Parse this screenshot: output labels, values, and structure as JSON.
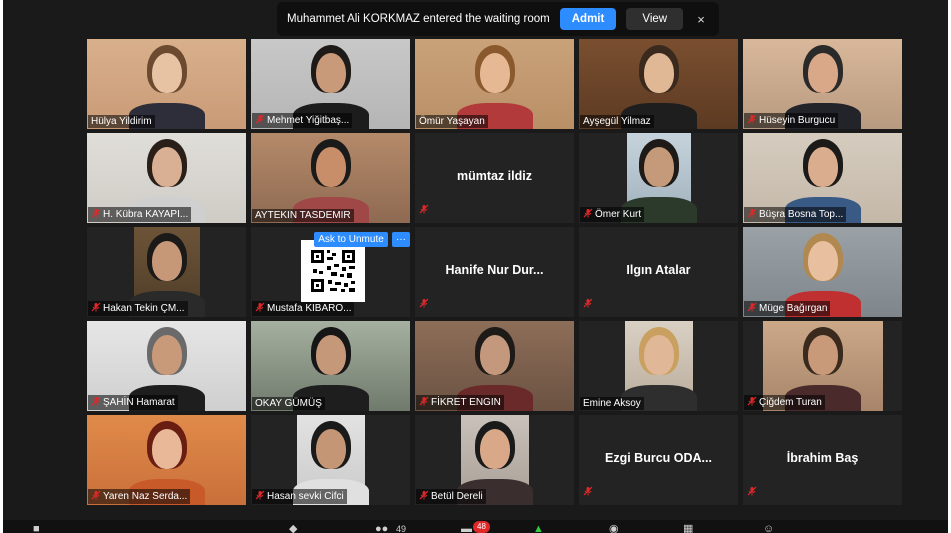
{
  "notification": {
    "message": "Muhammet Ali KORKMAZ entered the waiting room",
    "admit_label": "Admit",
    "view_label": "View",
    "close_label": "×"
  },
  "popup": {
    "ask_unmute_label": "Ask to Unmute",
    "more_label": "···"
  },
  "participants": [
    {
      "name": "Hülya Yildirim",
      "muted": false
    },
    {
      "name": "Mehmet Yiğitbaş...",
      "muted": true
    },
    {
      "name": "Ömür Yaşayan",
      "muted": false
    },
    {
      "name": "Ayşegül Yilmaz",
      "muted": false
    },
    {
      "name": "Hüseyin Burgucu",
      "muted": true
    },
    {
      "name": "H. Kübra KAYAPI...",
      "muted": true
    },
    {
      "name": "AYTEKIN TASDEMIR",
      "muted": false
    },
    {
      "name": "mümtaz ildiz",
      "muted": true,
      "video_off": true
    },
    {
      "name": "Ömer Kurt",
      "muted": true
    },
    {
      "name": "Büşra Bosna Top...",
      "muted": true
    },
    {
      "name": "Hakan Tekin ÇM...",
      "muted": true
    },
    {
      "name": "Mustafa KIBARO...",
      "muted": true
    },
    {
      "name": "Hanife Nur Dur...",
      "muted": true,
      "video_off": true
    },
    {
      "name": "Ilgın Atalar",
      "muted": true,
      "video_off": true
    },
    {
      "name": "Müge Bağırgan",
      "muted": true
    },
    {
      "name": "ŞAHİN Hamarat",
      "muted": true
    },
    {
      "name": "OKAY GÜMÜŞ",
      "muted": false,
      "active_speaker": true
    },
    {
      "name": "FİKRET ENGIN",
      "muted": true
    },
    {
      "name": "Emine Aksoy",
      "muted": false
    },
    {
      "name": "Çiğdem Turan",
      "muted": true
    },
    {
      "name": "Yaren Naz Serda...",
      "muted": true
    },
    {
      "name": "Hasan sevki Cifci",
      "muted": true
    },
    {
      "name": "Betül Dereli",
      "muted": true
    },
    {
      "name": "Ezgi Burcu ODA...",
      "muted": true,
      "video_off": true
    },
    {
      "name": "İbrahim Baş",
      "muted": true,
      "video_off": true
    }
  ],
  "toolbar": {
    "participants_count": "49",
    "chat_badge": "48"
  },
  "colors": {
    "accent": "#2d8cff",
    "active_speaker_border": "#c9d62c",
    "muted_icon": "#e02828",
    "tile_bg": "#232323"
  }
}
